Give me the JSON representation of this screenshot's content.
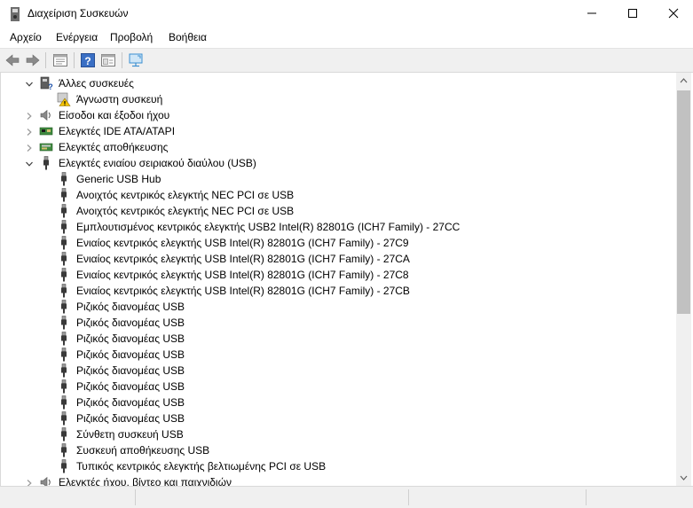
{
  "window": {
    "title": "Διαχείριση Συσκευών",
    "app_icon": "device-manager-icon"
  },
  "menu": [
    {
      "label": "Αρχείο"
    },
    {
      "label": "Ενέργεια"
    },
    {
      "label": "Προβολή"
    },
    {
      "label": "Βοήθεια"
    }
  ],
  "toolbar": {
    "icons": [
      "back-arrow-icon",
      "forward-arrow-icon",
      "properties-icon",
      "help-icon",
      "details-icon",
      "monitor-scan-icon"
    ]
  },
  "tree": {
    "nodes": [
      {
        "label": "Άλλες συσκευές",
        "icon": "other-devices-icon",
        "state": "expanded",
        "level": 0
      },
      {
        "label": "Άγνωστη συσκευή",
        "icon": "unknown-device-warning-icon",
        "state": "leaf",
        "level": 1
      },
      {
        "label": "Είσοδοι και έξοδοι ήχου",
        "icon": "speaker-icon",
        "state": "collapsed",
        "level": 0
      },
      {
        "label": "Ελεγκτές IDE ATA/ATAPI",
        "icon": "ide-controller-icon",
        "state": "collapsed",
        "level": 0
      },
      {
        "label": "Ελεγκτές αποθήκευσης",
        "icon": "storage-controller-icon",
        "state": "collapsed",
        "level": 0
      },
      {
        "label": "Ελεγκτές ενιαίου σειριακού διαύλου (USB)",
        "icon": "usb-plug-icon",
        "state": "expanded",
        "level": 0
      },
      {
        "label": "Generic USB Hub",
        "icon": "usb-plug-icon",
        "state": "leaf",
        "level": 1
      },
      {
        "label": "Ανοιχτός κεντρικός ελεγκτής NEC PCI σε USB",
        "icon": "usb-plug-icon",
        "state": "leaf",
        "level": 1
      },
      {
        "label": "Ανοιχτός κεντρικός ελεγκτής NEC PCI σε USB",
        "icon": "usb-plug-icon",
        "state": "leaf",
        "level": 1
      },
      {
        "label": "Εμπλουτισμένος κεντρικός ελεγκτής USB2 Intel(R) 82801G (ICH7 Family) - 27CC",
        "icon": "usb-plug-icon",
        "state": "leaf",
        "level": 1
      },
      {
        "label": "Ενιαίος κεντρικός ελεγκτής USB Intel(R) 82801G (ICH7 Family) - 27C9",
        "icon": "usb-plug-icon",
        "state": "leaf",
        "level": 1
      },
      {
        "label": "Ενιαίος κεντρικός ελεγκτής USB Intel(R) 82801G (ICH7 Family) - 27CA",
        "icon": "usb-plug-icon",
        "state": "leaf",
        "level": 1
      },
      {
        "label": "Ενιαίος κεντρικός ελεγκτής USB Intel(R) 82801G (ICH7 Family) - 27C8",
        "icon": "usb-plug-icon",
        "state": "leaf",
        "level": 1
      },
      {
        "label": "Ενιαίος κεντρικός ελεγκτής USB Intel(R) 82801G (ICH7 Family) - 27CB",
        "icon": "usb-plug-icon",
        "state": "leaf",
        "level": 1
      },
      {
        "label": "Ριζικός διανομέας USB",
        "icon": "usb-plug-icon",
        "state": "leaf",
        "level": 1
      },
      {
        "label": "Ριζικός διανομέας USB",
        "icon": "usb-plug-icon",
        "state": "leaf",
        "level": 1
      },
      {
        "label": "Ριζικός διανομέας USB",
        "icon": "usb-plug-icon",
        "state": "leaf",
        "level": 1
      },
      {
        "label": "Ριζικός διανομέας USB",
        "icon": "usb-plug-icon",
        "state": "leaf",
        "level": 1
      },
      {
        "label": "Ριζικός διανομέας USB",
        "icon": "usb-plug-icon",
        "state": "leaf",
        "level": 1
      },
      {
        "label": "Ριζικός διανομέας USB",
        "icon": "usb-plug-icon",
        "state": "leaf",
        "level": 1
      },
      {
        "label": "Ριζικός διανομέας USB",
        "icon": "usb-plug-icon",
        "state": "leaf",
        "level": 1
      },
      {
        "label": "Ριζικός διανομέας USB",
        "icon": "usb-plug-icon",
        "state": "leaf",
        "level": 1
      },
      {
        "label": "Σύνθετη συσκευή USB",
        "icon": "usb-plug-icon",
        "state": "leaf",
        "level": 1
      },
      {
        "label": "Συσκευή αποθήκευσης USB",
        "icon": "usb-plug-icon",
        "state": "leaf",
        "level": 1
      },
      {
        "label": "Τυπικός κεντρικός ελεγκτής βελτιωμένης PCI σε USB",
        "icon": "usb-plug-icon",
        "state": "leaf",
        "level": 1
      },
      {
        "label": "Ελεγκτές ήχου, βίντεο και παιχνιδιών",
        "icon": "speaker-icon",
        "state": "collapsed",
        "level": 0
      }
    ]
  },
  "colors": {
    "toolbar_bg": "#f0f0f0",
    "scrollbar_thumb": "#c1c1c1",
    "text": "#000000"
  }
}
